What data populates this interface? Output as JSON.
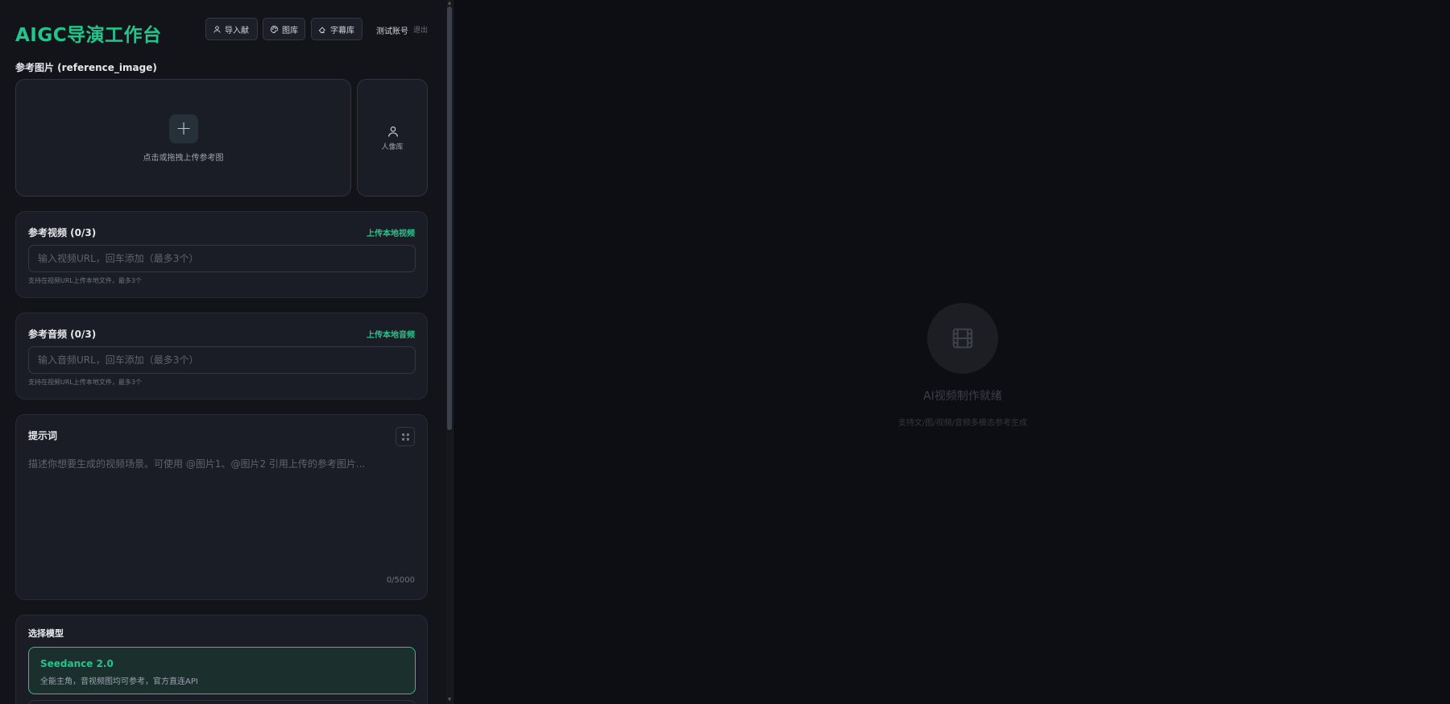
{
  "header": {
    "title": "AIGC导演工作台",
    "buttons": {
      "import_label": "导入献",
      "gallery_label": "图库",
      "subtitle_label": "字幕库"
    },
    "account_name": "测试账号",
    "logout_label": "退出"
  },
  "reference_image": {
    "label": "参考图片 (reference_image)",
    "upload_hint": "点击或拖拽上传参考图",
    "portrait_label": "人像库"
  },
  "reference_video": {
    "title": "参考视频 (0/3)",
    "upload_link": "上传本地视频",
    "placeholder": "输入视频URL，回车添加（最多3个）",
    "hint": "支持在视频URL上传本地文件，最多3个"
  },
  "reference_audio": {
    "title": "参考音频 (0/3)",
    "upload_link": "上传本地音频",
    "placeholder": "输入音频URL，回车添加（最多3个）",
    "hint": "支持在视频URL上传本地文件，最多3个"
  },
  "prompt": {
    "title": "提示词",
    "placeholder": "描述你想要生成的视频场景。可使用 @图片1、@图片2 引用上传的参考图片...",
    "char_count": "0/5000"
  },
  "model": {
    "title": "选择模型",
    "selected_name": "Seedance 2.0",
    "selected_desc": "全能主角，音视频图均可参考，官方直连API"
  },
  "empty_state": {
    "title": "AI视频制作就绪",
    "subtitle": "支持文/图/视频/音频多模态参考生成"
  },
  "colors": {
    "accent": "#22c58b",
    "background": "#0d0e13",
    "panel": "#1a1d25"
  }
}
